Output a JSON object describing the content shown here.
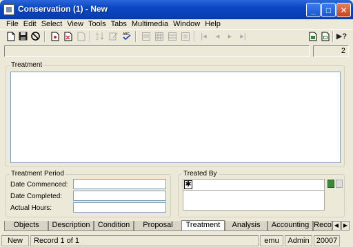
{
  "window": {
    "title": "Conservation (1) - New",
    "minimize": "_",
    "maximize": "□",
    "close": "✕"
  },
  "menu": [
    "File",
    "Edit",
    "Select",
    "View",
    "Tools",
    "Tabs",
    "Multimedia",
    "Window",
    "Help"
  ],
  "toolbar": {
    "icons": [
      "new-icon",
      "save-icon",
      "cancel-icon",
      "page-icon",
      "page-delete-icon",
      "page-copy-icon",
      "sort-icon",
      "edit-icon",
      "spellcheck-icon",
      "view1-icon",
      "view2-icon",
      "view3-icon",
      "view4-icon",
      "first-icon",
      "prev-icon",
      "next-icon",
      "last-icon",
      "doc-green-icon",
      "doc-green2-icon",
      "help-icon"
    ]
  },
  "record_count": "2",
  "treatment": {
    "label": "Treatment",
    "value": ""
  },
  "treatment_period": {
    "label": "Treatment Period",
    "date_commenced_label": "Date Commenced:",
    "date_completed_label": "Date Completed:",
    "actual_hours_label": "Actual Hours:",
    "date_commenced": "",
    "date_completed": "",
    "actual_hours": ""
  },
  "treated_by": {
    "label": "Treated By",
    "new_row_marker": "✱"
  },
  "tabs": [
    "Objects",
    "Description",
    "Condition",
    "Proposal",
    "Treatment",
    "Analysis",
    "Accounting",
    "Reco"
  ],
  "active_tab": "Treatment",
  "statusbar": {
    "mode": "New",
    "record": "Record 1 of 1",
    "db": "emu",
    "user": "Admin",
    "port": "20007"
  }
}
